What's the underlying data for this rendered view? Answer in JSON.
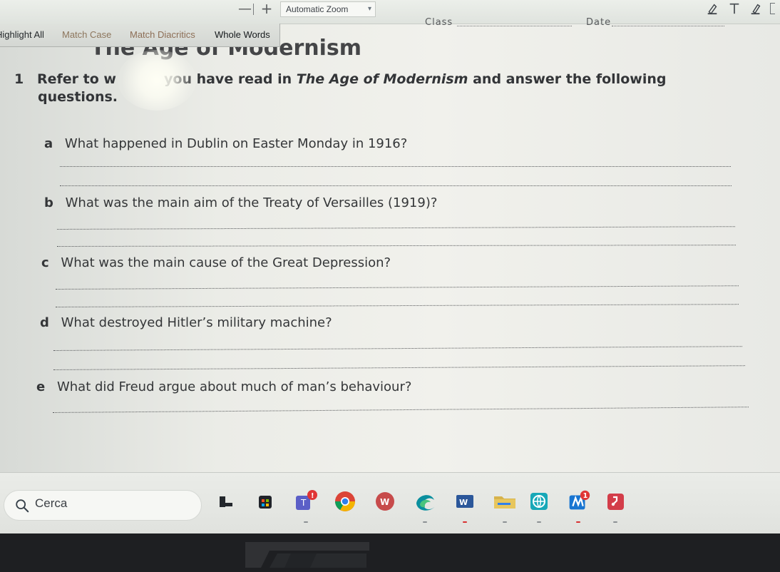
{
  "toolbar": {
    "zoom_minus": "—",
    "zoom_plus": "+",
    "zoom_level": "Automatic Zoom"
  },
  "findbar": {
    "highlight_all": "Highlight All",
    "match_case": "Match Case",
    "match_diacritics": "Match Diacritics",
    "whole_words": "Whole Words"
  },
  "worksheet": {
    "class_label": "Class",
    "date_label": "Date",
    "title": "The Age of Modernism",
    "instruction_number": "1",
    "instruction_part_a": "Refer to w",
    "instruction_part_b": "you have read in",
    "instruction_title": "The Age of Modernism",
    "instruction_part_c": "and answer the following",
    "instruction_part_d": "questions.",
    "questions": [
      {
        "letter": "a",
        "text": "What happened in Dublin on Easter Monday in 1916?"
      },
      {
        "letter": "b",
        "text": "What was the main aim of the Treaty of Versailles (1919)?"
      },
      {
        "letter": "c",
        "text": "What was the main cause of the Great Depression?"
      },
      {
        "letter": "d",
        "text": "What destroyed Hitler’s military machine?"
      },
      {
        "letter": "e",
        "text": "What did Freud argue about much of man’s behaviour?"
      }
    ]
  },
  "taskbar": {
    "search_label": "Cerca",
    "notification_badge": "1",
    "word_label": "W",
    "teams_label": "T",
    "colors": {
      "taskbar_background": "#e6e8e4",
      "accent_blue": "#2f80ed",
      "word_blue": "#2b579a",
      "teams_purple": "#5b5fc7",
      "chrome_red": "#db4437",
      "chrome_yellow": "#f4b400",
      "chrome_green": "#0f9d58",
      "notification_red": "#e03535"
    }
  }
}
